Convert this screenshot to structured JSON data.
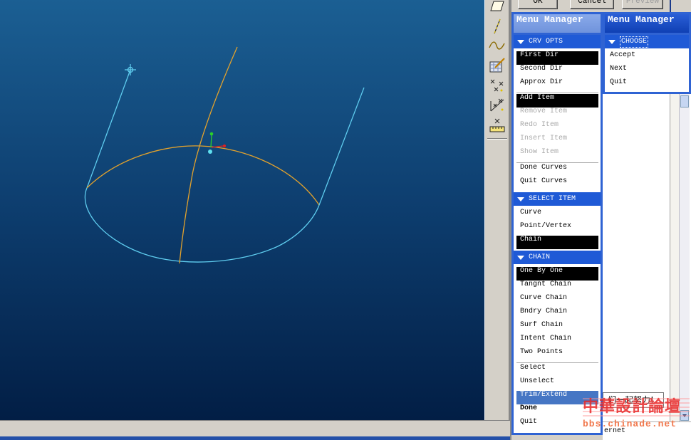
{
  "colors": {
    "viewport_top": "#1b5f93",
    "viewport_mid": "#0d3d6e",
    "viewport_bottom": "#021e45",
    "menu_frame": "#2f63d3",
    "menu_header": "#1f5ad6",
    "highlight": "#4676c4",
    "curve_cyan": "#5fcdef",
    "curve_orange": "#e3a22c"
  },
  "dialog": {
    "buttons": [
      {
        "label": "OK",
        "state": "normal"
      },
      {
        "label": "Cancel",
        "state": "normal"
      },
      {
        "label": "Preview",
        "state": "disabled"
      }
    ]
  },
  "toolbar": {
    "icons": [
      "datum-plane-icon",
      "datum-axis-icon",
      "datum-curve-icon",
      "sketch-tool-icon",
      "datum-point-icon",
      "offset-coordinate-point-icon",
      "field-point-icon"
    ]
  },
  "menu_left": {
    "title": "Menu Manager",
    "sections": [
      {
        "header": "CRV OPTS",
        "groups": [
          [
            {
              "label": "First Dir",
              "state": "selected"
            },
            {
              "label": "Second Dir",
              "state": "normal"
            },
            {
              "label": "Approx Dir",
              "state": "normal"
            }
          ],
          [
            {
              "label": "Add Item",
              "state": "selected"
            },
            {
              "label": "Remove Item",
              "state": "disabled"
            },
            {
              "label": "Redo Item",
              "state": "disabled"
            },
            {
              "label": "Insert Item",
              "state": "disabled"
            },
            {
              "label": "Show Item",
              "state": "disabled"
            }
          ],
          [
            {
              "label": "Done Curves",
              "state": "normal"
            },
            {
              "label": "Quit Curves",
              "state": "normal"
            }
          ]
        ]
      },
      {
        "header": "SELECT ITEM",
        "groups": [
          [
            {
              "label": "Curve",
              "state": "normal"
            },
            {
              "label": "Point/Vertex",
              "state": "normal"
            },
            {
              "label": "Chain",
              "state": "selected"
            }
          ]
        ]
      },
      {
        "header": "CHAIN",
        "groups": [
          [
            {
              "label": "One By One",
              "state": "selected"
            },
            {
              "label": "Tangnt Chain",
              "state": "normal"
            },
            {
              "label": "Curve Chain",
              "state": "normal"
            },
            {
              "label": "Bndry Chain",
              "state": "normal"
            },
            {
              "label": "Surf Chain",
              "state": "normal"
            },
            {
              "label": "Intent Chain",
              "state": "normal"
            },
            {
              "label": "Two Points",
              "state": "normal"
            }
          ],
          [
            {
              "label": "Select",
              "state": "normal"
            },
            {
              "label": "Unselect",
              "state": "normal"
            },
            {
              "label": "Trim/Extend",
              "state": "highlighted"
            },
            {
              "label": "Done",
              "state": "default"
            },
            {
              "label": "Quit",
              "state": "normal"
            }
          ]
        ]
      }
    ]
  },
  "menu_right": {
    "title": "Menu Manager",
    "sections": [
      {
        "header": "CHOOSE",
        "groups": [
          [
            {
              "label": "Accept",
              "state": "normal"
            },
            {
              "label": "Next",
              "state": "normal"
            },
            {
              "label": "Quit",
              "state": "normal"
            }
          ]
        ]
      }
    ]
  },
  "background_window": {
    "tooltip_text": "们一起努力!",
    "footer_fragment": "ernet"
  },
  "watermark": {
    "title": "中華設計論壇",
    "url": "bbs.chinade.net"
  }
}
